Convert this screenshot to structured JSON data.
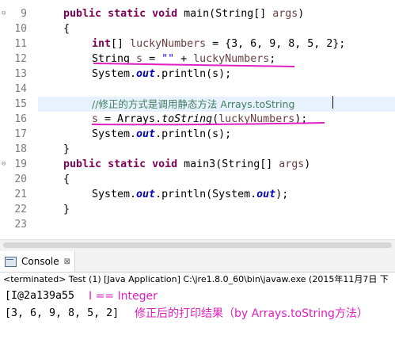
{
  "editor": {
    "line_numbers": [
      "9",
      "10",
      "11",
      "12",
      "13",
      "14",
      "15",
      "16",
      "17",
      "18",
      "19",
      "20",
      "21",
      "22",
      "23"
    ],
    "fold_markers": {
      "line9": "⊖",
      "line19": "⊖"
    },
    "lines": {
      "l9": {
        "kw1": "public",
        "kw2": "static",
        "kw3": "void",
        "rest": " main(String[] ",
        "var": "args",
        "end": ")"
      },
      "l10": {
        "text": "{"
      },
      "l11": {
        "kw": "int",
        "rest": "[] ",
        "var": "luckyNumbers",
        "end": " = {3, 6, 9, 8, 5, 2};"
      },
      "l12": {
        "pre": "String ",
        "var1": "s",
        "mid": " = ",
        "str": "\"\"",
        "mid2": " + ",
        "var2": "luckyNumbers",
        "end": ";"
      },
      "l13": {
        "pre": "System.",
        "fld": "out",
        "end": ".println(s);"
      },
      "l15": {
        "text": "//修正的方式是调用静态方法 Arrays.toString"
      },
      "l16": {
        "var1": "s",
        "mid": " = Arrays.",
        "mth": "toString",
        "open": "(",
        "var2": "luckyNumbers",
        "end": ");"
      },
      "l17": {
        "pre": "System.",
        "fld": "out",
        "end": ".println(s);"
      },
      "l18": {
        "text": "}"
      },
      "l19": {
        "kw1": "public",
        "kw2": "static",
        "kw3": "void",
        "rest": " main3(String[] ",
        "var": "args",
        "end": ")"
      },
      "l20": {
        "text": "{"
      },
      "l21": {
        "pre": "System.",
        "fld": "out",
        "mid": ".println(System.",
        "fld2": "out",
        "end": ");"
      },
      "l22": {
        "text": "}"
      }
    }
  },
  "console": {
    "tab_label": "Console",
    "close_glyph": "⊠",
    "status": "<terminated> Test (1) [Java Application] C:\\jre1.8.0_60\\bin\\javaw.exe (2015年11月7日 下",
    "output_line1": "[I@2a139a55",
    "output_line2": "[3, 6, 9, 8, 5, 2]",
    "annotation1": "I == Integer",
    "annotation2": "修正后的打印结果（by Arrays.toString方法）"
  },
  "colors": {
    "annotation": "#e020c0",
    "keyword": "#7f0055",
    "string": "#2a00ff",
    "field": "#0000c0",
    "comment": "#3f7f5f",
    "current_line": "#e8f2fe"
  }
}
